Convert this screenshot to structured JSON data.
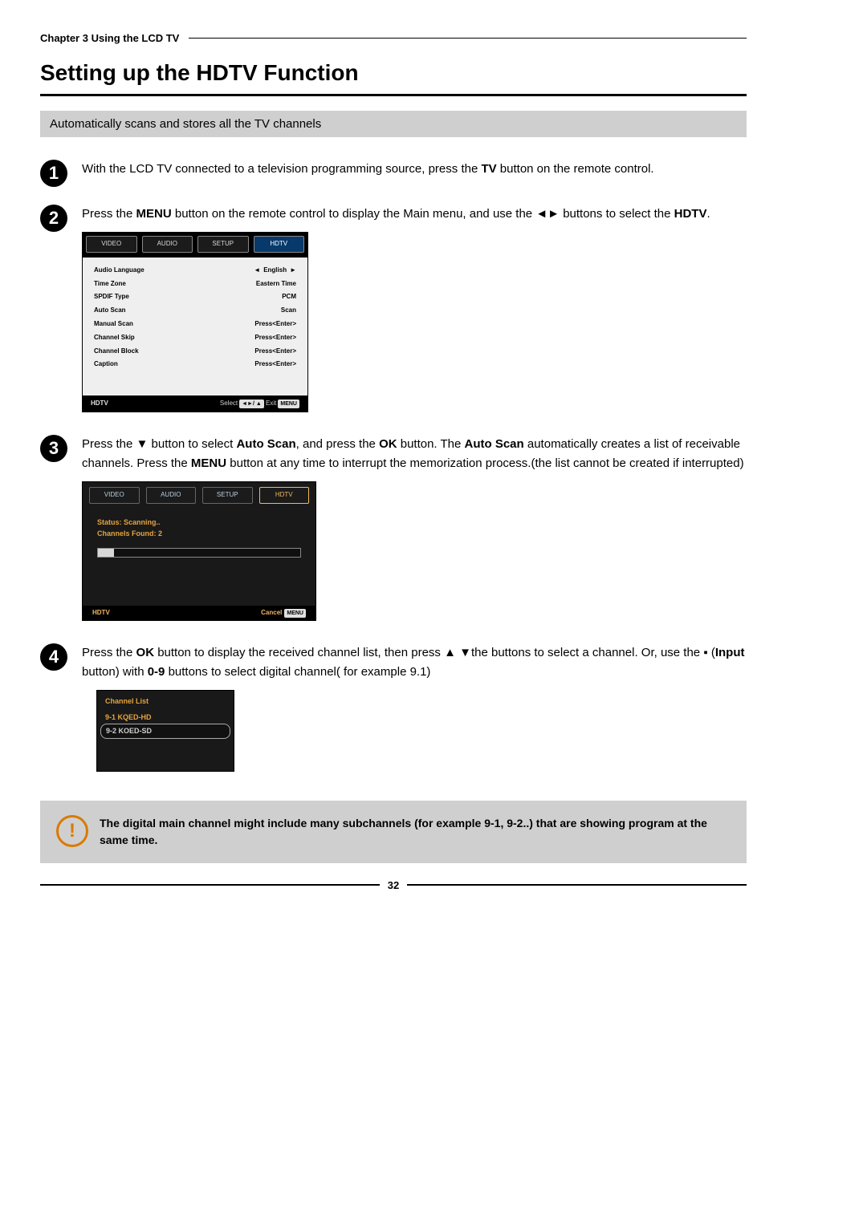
{
  "header": {
    "chapter": "Chapter 3 Using the LCD TV",
    "title": "Setting up the HDTV Function",
    "subhead": "Automatically scans and stores all the TV channels"
  },
  "steps": {
    "s1": {
      "num": "1",
      "pre": "With the LCD TV connected to a television programming source, press the ",
      "bold1": "TV",
      "post": " button on the remote control."
    },
    "s2": {
      "num": "2",
      "pre": "Press the ",
      "bold1": "MENU",
      "mid": " button on the remote control to display the Main menu, and use the ",
      "arrows": "◄►",
      "mid2": " buttons to select the ",
      "bold2": "HDTV",
      "post": "."
    },
    "s3": {
      "num": "3",
      "pre": "Press the ",
      "arrow": "▼",
      "mid1": " button to select ",
      "bold1": "Auto Scan",
      "mid2": ", and press the ",
      "bold2": "OK",
      "mid3": " button. The ",
      "bold3": "Auto Scan",
      "mid4": " automatically creates a list of receivable channels. Press the ",
      "bold4": "MENU",
      "post": " button at any time to interrupt the memorization process.(the list cannot be created if interrupted)"
    },
    "s4": {
      "num": "4",
      "pre": "Press the ",
      "bold1": "OK",
      "mid1": " button to display the received channel list, then press ",
      "arrows": "▲ ▼",
      "mid2": "the buttons to select a channel. Or, use the ",
      "dot": "▪",
      "mid3": " (",
      "bold2": "Input",
      "mid4": " button) with ",
      "bold3": "0-9",
      "post": " buttons to select digital channel( for example 9.1)"
    }
  },
  "menu1": {
    "tabs": {
      "video": "VIDEO",
      "audio": "AUDIO",
      "setup": "SETUP",
      "hdtv": "HDTV"
    },
    "rows": [
      {
        "label": "Audio Language",
        "val": "English",
        "arrows": true
      },
      {
        "label": "Time Zone",
        "val": "Eastern Time"
      },
      {
        "label": "SPDIF Type",
        "val": "PCM"
      },
      {
        "label": "Auto Scan",
        "val": "Scan"
      },
      {
        "label": "Manual Scan",
        "val": "Press<Enter>"
      },
      {
        "label": "Channel Skip",
        "val": "Press<Enter>"
      },
      {
        "label": "Channel Block",
        "val": "Press<Enter>"
      },
      {
        "label": "Caption",
        "val": "Press<Enter>"
      }
    ],
    "footer": {
      "left": "HDTV",
      "select": "Select",
      "select_keys": "◄►/ ▲",
      "exit": "Exit",
      "exit_key": "MENU"
    }
  },
  "menu2": {
    "tabs": {
      "video": "VIDEO",
      "audio": "AUDIO",
      "setup": "SETUP",
      "hdtv": "HDTV"
    },
    "status": "Status: Scanning..",
    "found": "Channels Found: 2",
    "footer": {
      "left": "HDTV",
      "cancel": "Cancel",
      "cancel_key": "MENU"
    }
  },
  "chlist": {
    "hdr": "Channel List",
    "items": [
      "9-1 KQED-HD",
      "9-2 KOED-SD"
    ]
  },
  "warn": {
    "text": "The digital main channel might include many subchannels (for example 9-1, 9-2..) that are showing program at the same time."
  },
  "page": "32"
}
